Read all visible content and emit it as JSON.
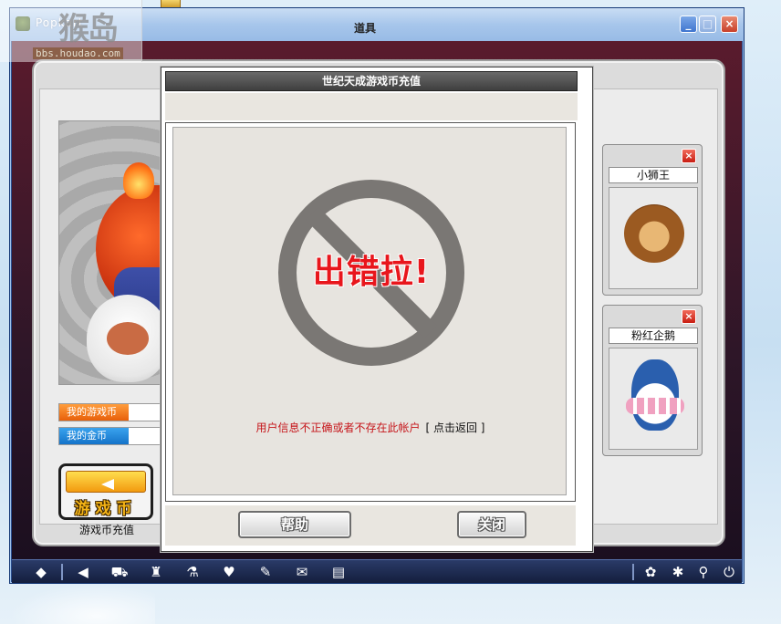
{
  "window": {
    "title": "Popkart",
    "minimize_label": "_",
    "maximize_label": "□",
    "close_label": "×"
  },
  "watermark": {
    "logo": "猴岛",
    "url": "bbs.houdao.com"
  },
  "shop": {
    "title": "道具",
    "my_game_coins_label": "我的游戏币",
    "my_gold_label": "我的金币",
    "recharge_button_text": "游戏币",
    "recharge_caption": "游戏币充值"
  },
  "items": [
    {
      "name": "小狮王"
    },
    {
      "name": "粉红企鹅"
    }
  ],
  "dialog": {
    "title": "世纪天成游戏币充值",
    "error_title": "出错拉!",
    "message": "用户信息不正确或者不存在此帐户",
    "return_link": "[ 点击返回 ]",
    "help_button": "帮助",
    "close_button": "关闭"
  },
  "toolbar_icons": [
    "home-icon",
    "back-icon",
    "cart-icon",
    "trophy-icon",
    "potion-icon",
    "heart-icon",
    "wrench-icon",
    "scroll-icon",
    "book-icon",
    "community-icon",
    "settings-icon",
    "search-icon",
    "power-icon"
  ],
  "colors": {
    "error_red": "#e8161c",
    "coin_orange": "#e8600a",
    "gold_blue": "#1473c9"
  }
}
